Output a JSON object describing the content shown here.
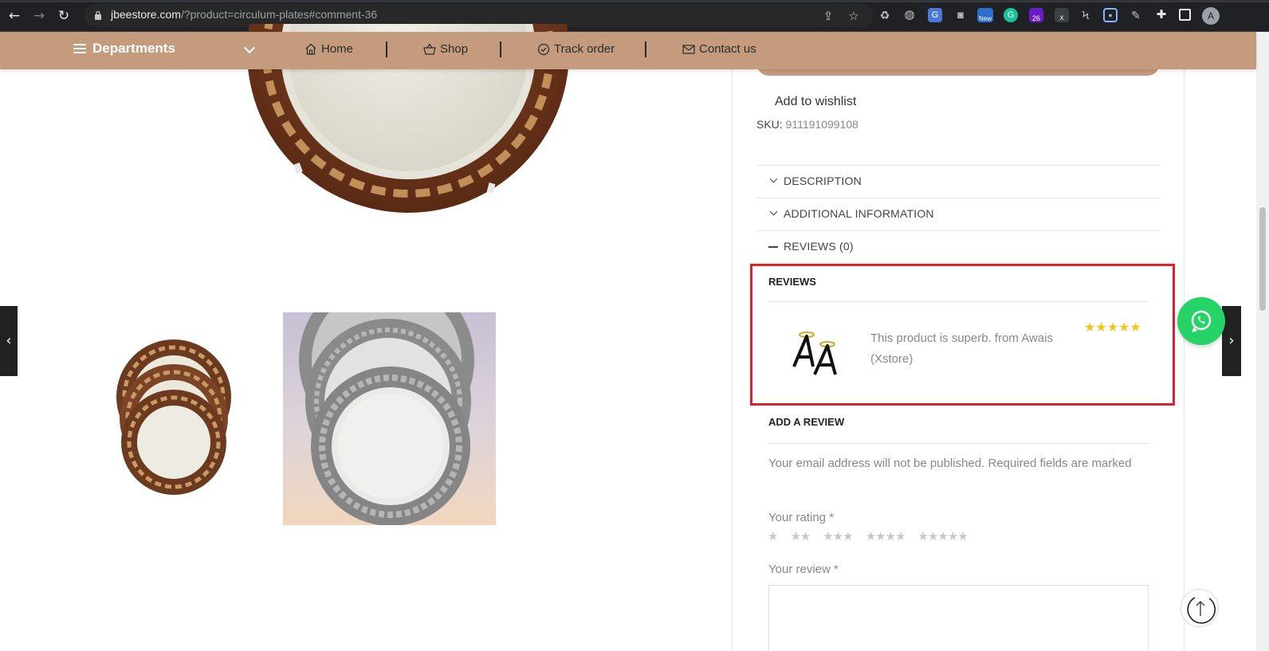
{
  "browser": {
    "url_host": "jbeestore.com",
    "url_path": "/?product=circulum-plates#comment-36",
    "profile_initial": "A",
    "ext_badge_new": "New",
    "ext_badge_26": "26",
    "ext_badge_x": "x"
  },
  "header": {
    "departments_label": "Departments",
    "menu": [
      {
        "label": "Home",
        "icon": "home-icon"
      },
      {
        "label": "Shop",
        "icon": "basket-icon"
      },
      {
        "label": "Track order",
        "icon": "check-circle-icon"
      },
      {
        "label": "Contact us",
        "icon": "envelope-icon"
      }
    ]
  },
  "summary": {
    "wishlist_label": "Add to wishlist",
    "sku_label": "SKU:",
    "sku_value": "911191099108"
  },
  "tabs": [
    {
      "label": "DESCRIPTION",
      "state": "collapsed"
    },
    {
      "label": "ADDITIONAL INFORMATION",
      "state": "collapsed"
    },
    {
      "label": "REVIEWS (0)",
      "state": "expanded"
    }
  ],
  "reviews": {
    "title": "REVIEWS",
    "items": [
      {
        "text": "This product is superb. from Awais (Xstore)",
        "rating": 5,
        "stars": "★★★★★"
      }
    ]
  },
  "add_review": {
    "title": "ADD A REVIEW",
    "notes": "Your email address will not be published. Required fields are marked",
    "rating_label": "Your rating *",
    "rating_options": [
      "★",
      "★★",
      "★★★",
      "★★★★",
      "★★★★★"
    ],
    "review_label": "Your review *"
  },
  "colors": {
    "header_bg": "#c59b7e",
    "highlight": "#e0202f",
    "star": "#f5c518",
    "whatsapp": "#25d366"
  }
}
